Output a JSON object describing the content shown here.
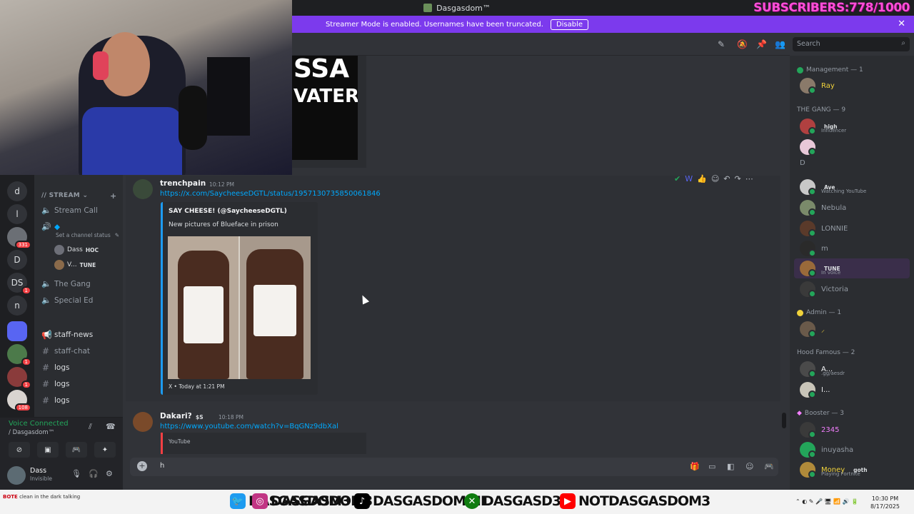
{
  "window": {
    "title": "Dasgasdom™",
    "subscriber_counter": "SUBSCRIBERS:778/1000"
  },
  "banner": {
    "text": "Streamer Mode is enabled. Usernames have been truncated.",
    "button": "Disable"
  },
  "search": {
    "placeholder": "Search"
  },
  "rail": [
    {
      "label": "d"
    },
    {
      "label": "l"
    },
    {
      "label": "",
      "badge": "331"
    },
    {
      "label": "D"
    },
    {
      "label": "DS",
      "badge": "1"
    },
    {
      "label": "n"
    },
    {
      "label": ""
    },
    {
      "label": "",
      "badge": "1"
    },
    {
      "label": "",
      "badge": "1"
    },
    {
      "label": "",
      "badge": "108"
    }
  ],
  "sidebar": {
    "category_stream": "// STREAM",
    "stream_call": "Stream Call",
    "set_status": "Set a channel status",
    "voice_users": [
      {
        "name": "Dass",
        "tag": "HOC"
      },
      {
        "name": "V...",
        "tag": "TUNE"
      }
    ],
    "the_gang": "The Gang",
    "special_ed": "Special Ed",
    "text_channels": [
      "staff-news",
      "staff-chat",
      "logs",
      "logs",
      "logs"
    ]
  },
  "voice_panel": {
    "status": "Voice Connected",
    "location": "/ Dasgasdom™"
  },
  "user_panel": {
    "name": "Dass",
    "status": "Invisible"
  },
  "top_image": {
    "line1": "SSA",
    "line2": "VATER"
  },
  "messages": [
    {
      "author": "trenchpain",
      "time": "10:12 PM",
      "link": "https://x.com/SaycheeseDGTL/status/1957130735850061846",
      "embed": {
        "title": "SAY CHEESE! (@SaycheeseDGTL)",
        "description": "New pictures of Blueface in prison",
        "footer": "X • Today at 1:21 PM"
      }
    },
    {
      "author": "Dakari?",
      "badge": "$S",
      "time": "10:18 PM",
      "link": "https://www.youtube.com/watch?v=BqGNz9dbXal",
      "embed": {
        "provider": "YouTube"
      }
    }
  ],
  "composer": {
    "value": "h"
  },
  "members": {
    "management": {
      "label": "Management — 1",
      "members": [
        {
          "name": "Ray"
        }
      ]
    },
    "the_gang": {
      "label": "THE GANG — 9",
      "members": [
        {
          "name": "high",
          "activity": "Influencer"
        },
        {
          "name": "",
          "activity": ""
        },
        {
          "name": "D",
          "activity": ""
        },
        {
          "name": "Ave",
          "activity": "Watching YouTube"
        },
        {
          "name": "Nebula",
          "activity": ""
        },
        {
          "name": "LONNIE",
          "activity": ""
        },
        {
          "name": "m",
          "activity": ""
        },
        {
          "name": "TUNE",
          "activity": "In voice"
        },
        {
          "name": "Victoria",
          "activity": ""
        }
      ]
    },
    "admin": {
      "label": "Admin — 1",
      "members": [
        {
          "name": ""
        }
      ]
    },
    "hood_famous": {
      "label": "Hood Famous — 2",
      "members": [
        {
          "name": "A...",
          "activity": ".gg/aesdr"
        },
        {
          "name": "I..."
        }
      ]
    },
    "booster": {
      "label": "Booster — 3",
      "members": [
        {
          "name": "2345"
        },
        {
          "name": "inuyasha"
        },
        {
          "name": "Money",
          "tag": "goth",
          "activity": "Playing Fortnite"
        }
      ]
    }
  },
  "socials": [
    {
      "network": "twitter",
      "handle": "DASGASDOM3",
      "color": "#1d9bf0"
    },
    {
      "network": "instagram",
      "handle": "DASGASDOM3",
      "color": "#c13584"
    },
    {
      "network": "tiktok",
      "handle": "DASGASDOMINI",
      "color": "#000000"
    },
    {
      "network": "xbox",
      "handle": "DASGASD3M",
      "color": "#107c10"
    },
    {
      "network": "youtube",
      "handle": "NOTDASGASDOM3",
      "color": "#ff0000"
    }
  ],
  "tray": {
    "time": "10:30 PM",
    "date": "8/17/2025"
  },
  "chat_overlay": {
    "user": "BOTE",
    "text": "clean in the dark talking"
  }
}
